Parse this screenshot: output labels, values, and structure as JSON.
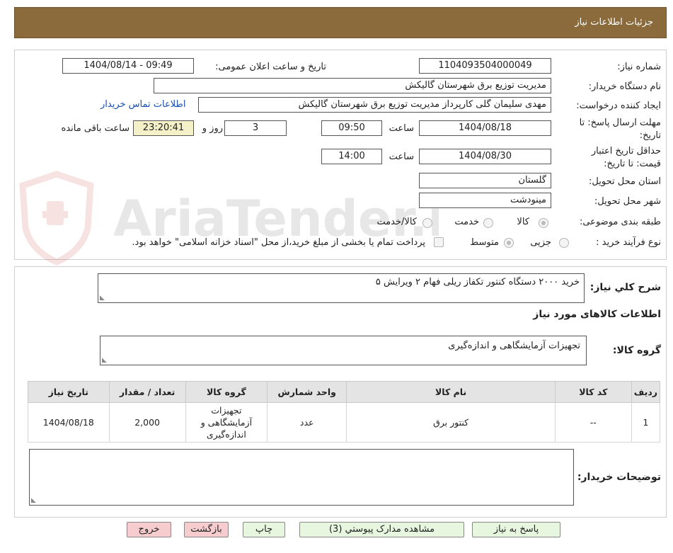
{
  "header": {
    "title": "جزئیات اطلاعات نیاز"
  },
  "form": {
    "need_number_label": "شماره نیاز:",
    "need_number": "1104093504000049",
    "announce_label": "تاریخ و ساعت اعلان عمومی:",
    "announce_value": "1404/08/14 - 09:49",
    "buyer_org_label": "نام دستگاه خریدار:",
    "buyer_org": "مدیریت توزیع برق شهرستان گالیکش",
    "creator_label": "ایجاد کننده درخواست:",
    "creator": "مهدی سلیمان گلی کارپرداز مدیریت توزیع برق شهرستان گالیکش",
    "contact_link": "اطلاعات تماس خریدار",
    "deadline_label_1": "مهلت ارسال پاسخ: تا",
    "deadline_label_2": "تاریخ:",
    "deadline_date": "1404/08/18",
    "time_label": "ساعت",
    "deadline_time": "09:50",
    "days_value": "3",
    "days_label": "روز و",
    "remaining_time": "23:20:41",
    "remaining_label": "ساعت باقی مانده",
    "validity_label_1": "حداقل تاریخ اعتبار",
    "validity_label_2": "قیمت: تا تاریخ:",
    "validity_date": "1404/08/30",
    "validity_time": "14:00",
    "province_label": "استان محل تحویل:",
    "province": "گلستان",
    "city_label": "شهر محل تحویل:",
    "city": "مینودشت",
    "category_label": "طبقه بندی موضوعی:",
    "category_options": [
      "کالا",
      "خدمت",
      "کالا/خدمت"
    ],
    "process_label": "نوع فرآیند خرید :",
    "process_options": [
      "جزیی",
      "متوسط"
    ],
    "payment_note": "پرداخت تمام یا بخشی از مبلغ خرید،از محل \"اسناد خزانه اسلامی\" خواهد بود."
  },
  "details": {
    "summary_label": "شرح کلي نياز:",
    "summary_text": "خرید ۲۰۰۰ دستگاه کنتور تکفاز ریلی فهام ۲ ویرایش ۵",
    "goods_section_title": "اطلاعات کالاهای مورد نیاز",
    "goods_group_label": "گروه کالا:",
    "goods_group_value": "تجهیزات آزمایشگاهی و اندازه‌گیری",
    "table": {
      "headers": [
        "ردیف",
        "کد کالا",
        "نام کالا",
        "واحد شمارش",
        "گروه کالا",
        "تعداد / مقدار",
        "تاریخ نیاز"
      ],
      "rows": [
        [
          "1",
          "--",
          "کنتور برق",
          "عدد",
          "تجهیزات آزمایشگاهی و اندازه‌گیری",
          "2,000",
          "1404/08/18"
        ]
      ]
    },
    "buyer_notes_label": "توضیحات خریدار:",
    "buyer_notes_value": ""
  },
  "buttons": {
    "reply": "پاسخ به نیاز",
    "attachments": "مشاهده مدارک پیوستي (3)",
    "print": "چاپ",
    "back": "بازگشت",
    "exit": "خروج"
  },
  "watermark": {
    "text": "AriaTender.neT"
  },
  "colors": {
    "header_bg": "#8b6b3c",
    "link": "#1a4fb5",
    "green_button": "#e6f6df",
    "pink_button": "#f6cccf",
    "remaining_bg": "#f4f0c8"
  }
}
